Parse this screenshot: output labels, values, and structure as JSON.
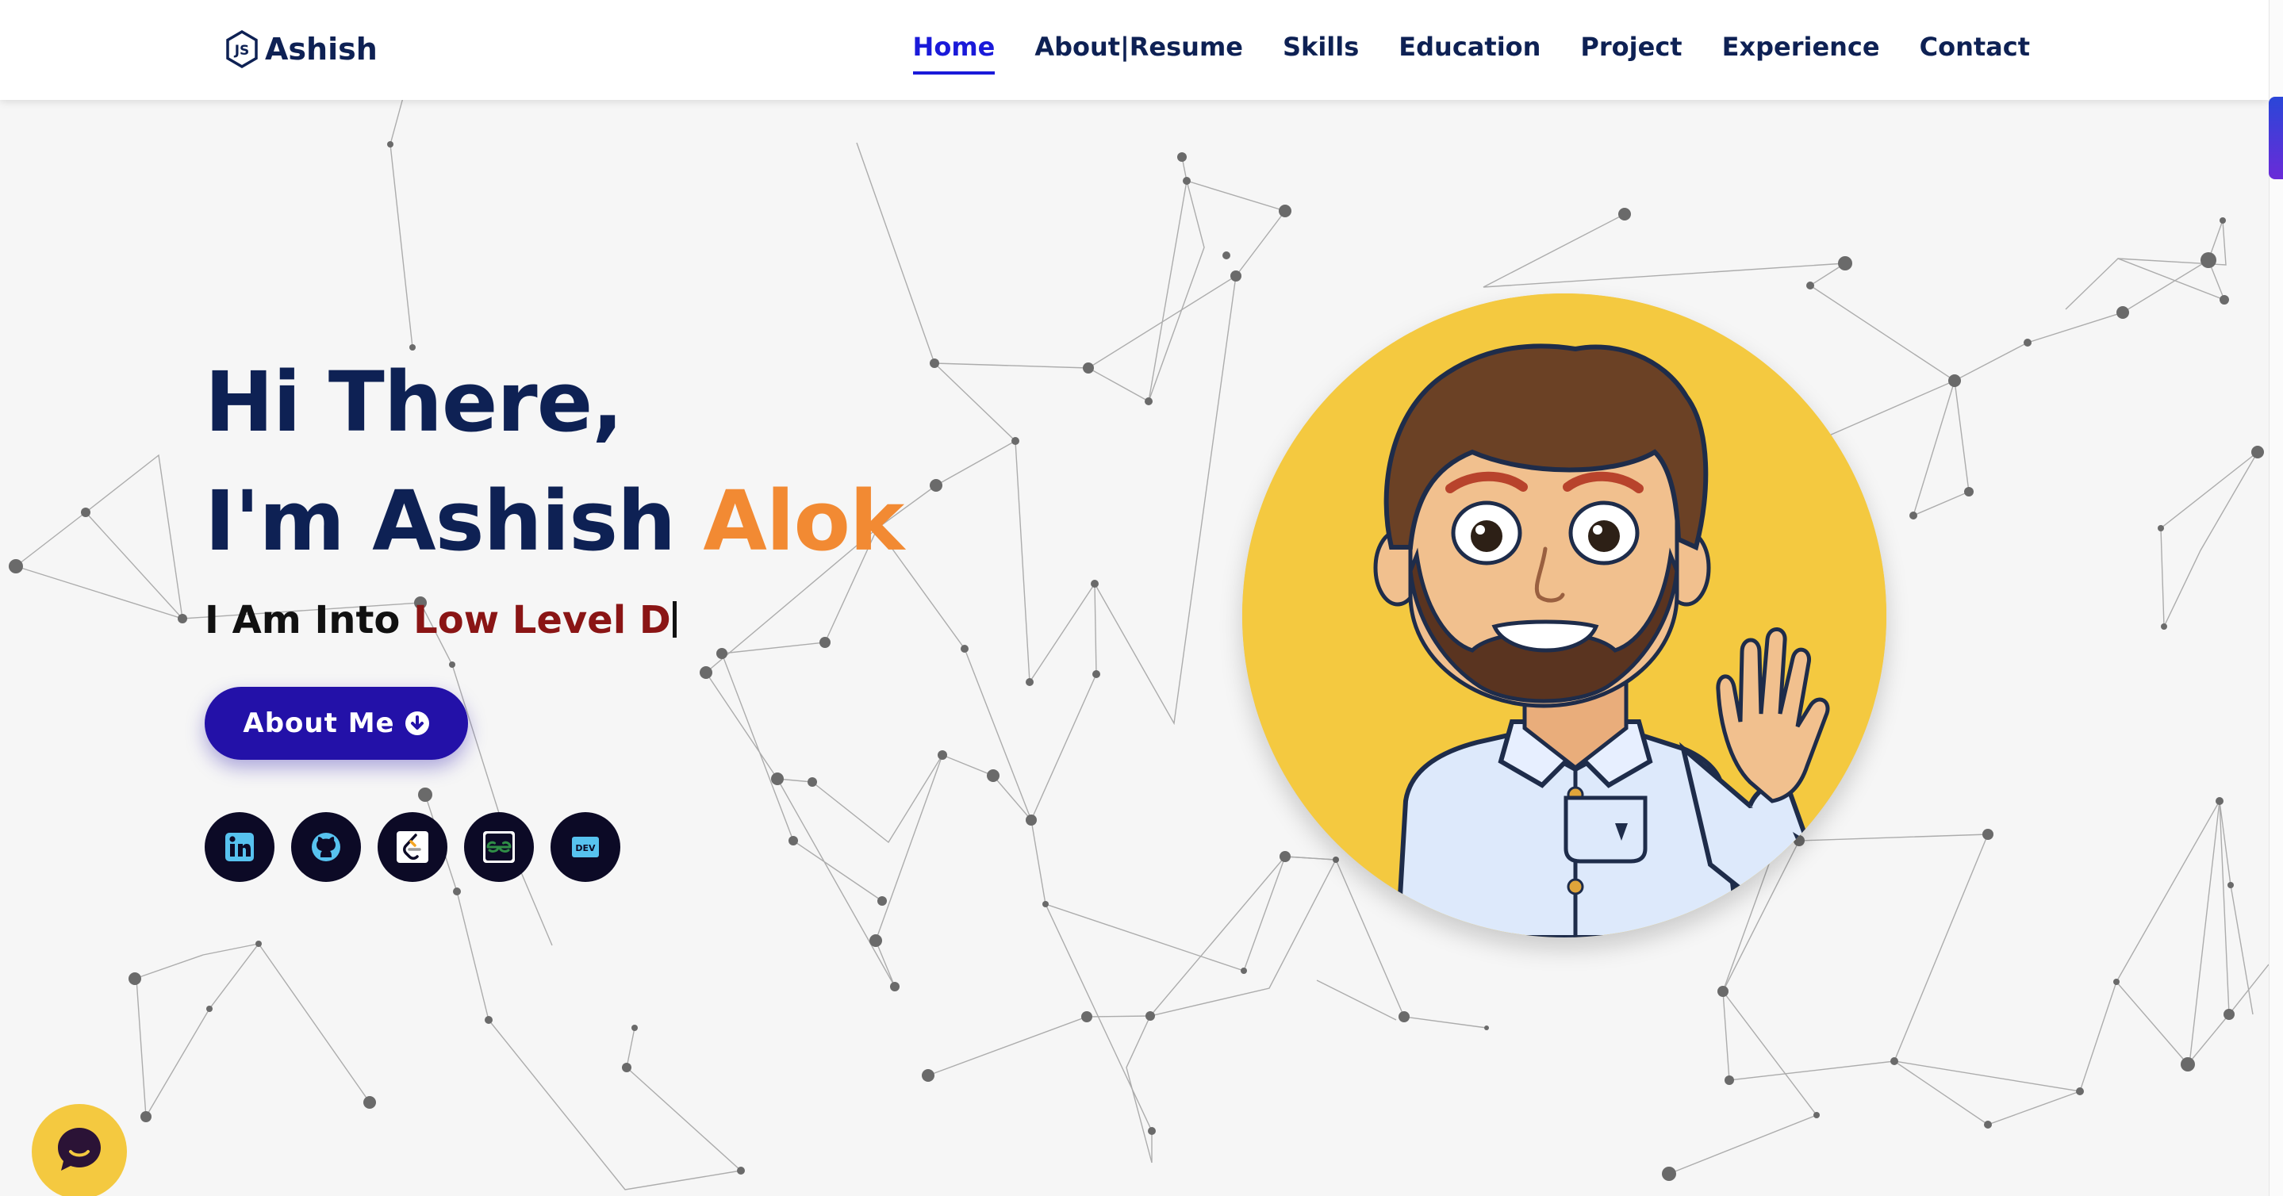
{
  "brand": {
    "name": "Ashish",
    "icon": "nodejs-icon"
  },
  "nav": {
    "items": [
      {
        "label": "Home",
        "active": true
      },
      {
        "label": "About|Resume",
        "active": false
      },
      {
        "label": "Skills",
        "active": false
      },
      {
        "label": "Education",
        "active": false
      },
      {
        "label": "Project",
        "active": false
      },
      {
        "label": "Experience",
        "active": false
      },
      {
        "label": "Contact",
        "active": false
      }
    ]
  },
  "hero": {
    "greeting": "Hi There,",
    "intro": "I'm Ashish",
    "surname": "Alok",
    "typing_prefix": "I Am Into",
    "typing_text": "Low Level D",
    "about_button": "About Me",
    "about_icon": "arrow-down-circle-icon"
  },
  "socials": [
    {
      "name": "linkedin",
      "icon": "linkedin-icon"
    },
    {
      "name": "github",
      "icon": "github-icon"
    },
    {
      "name": "leetcode",
      "icon": "leetcode-icon"
    },
    {
      "name": "geeksforgeeks",
      "icon": "geeksforgeeks-icon"
    },
    {
      "name": "dev",
      "icon": "dev-icon",
      "badge": "DEV"
    }
  ],
  "avatar": {
    "icon": "waving-avatar"
  },
  "chat": {
    "icon": "chat-icon"
  },
  "colors": {
    "navy": "#0e2154",
    "accent_blue": "#1a1ad9",
    "orange": "#f28a33",
    "maroon": "#8a1515",
    "button": "#2311a8",
    "avatar_bg": "#f4c940",
    "background": "#f6f6f6"
  }
}
